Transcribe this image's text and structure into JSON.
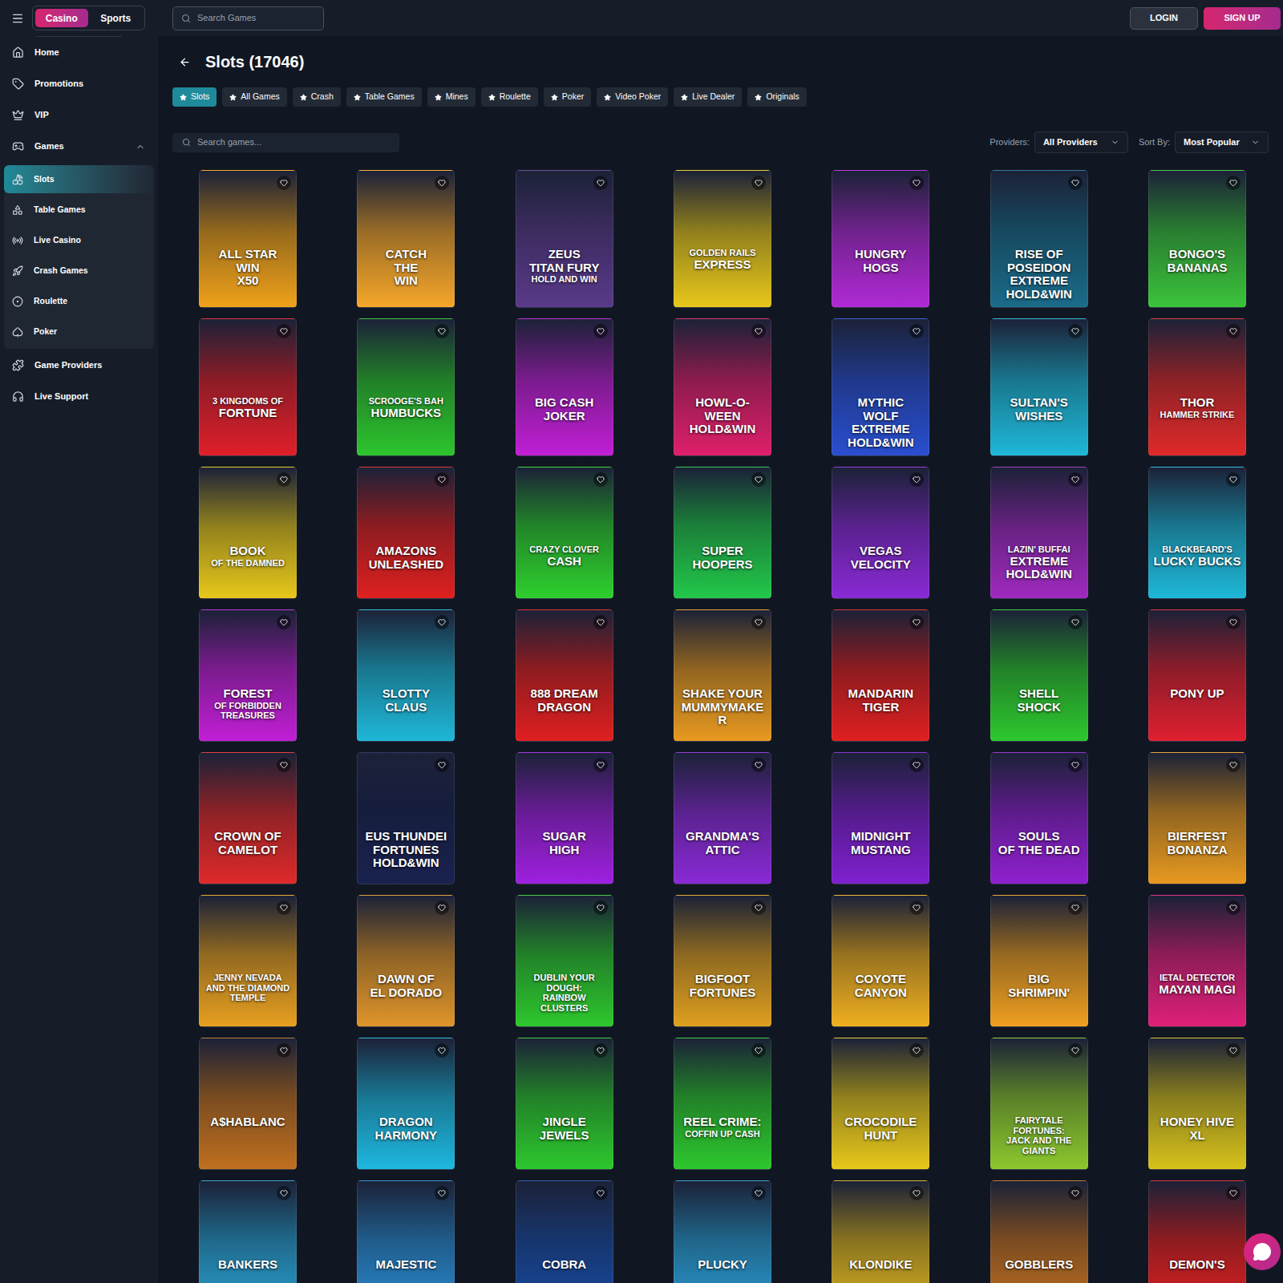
{
  "topbar": {
    "mode_toggle": [
      {
        "label": "Casino",
        "selected": true
      },
      {
        "label": "Sports",
        "selected": false
      }
    ],
    "search": {
      "placeholder": "Search Games"
    },
    "buttons": [
      {
        "label": "LOGIN",
        "kind": "secondary"
      },
      {
        "label": "SIGN UP",
        "kind": "primary"
      }
    ]
  },
  "sidebar": {
    "items": [
      {
        "label": "Home",
        "expanded": false,
        "children": []
      },
      {
        "label": "Promotions",
        "expanded": false,
        "children": []
      },
      {
        "label": "VIP",
        "expanded": false,
        "children": []
      },
      {
        "label": "Games",
        "expanded": true,
        "children": [
          {
            "label": "Slots",
            "selected": true
          },
          {
            "label": "Table Games",
            "selected": false
          },
          {
            "label": "Live Casino",
            "selected": false
          },
          {
            "label": "Crash Games",
            "selected": false
          },
          {
            "label": "Roulette",
            "selected": false
          },
          {
            "label": "Poker",
            "selected": false
          }
        ]
      },
      {
        "label": "Game Providers",
        "expanded": false,
        "children": []
      },
      {
        "label": "Live Support",
        "expanded": false,
        "children": []
      }
    ]
  },
  "page": {
    "title": "Slots (17046)",
    "filters": [
      {
        "label": "Slots",
        "selected": true
      },
      {
        "label": "All Games",
        "selected": false
      },
      {
        "label": "Crash",
        "selected": false
      },
      {
        "label": "Table Games",
        "selected": false
      },
      {
        "label": "Mines",
        "selected": false
      },
      {
        "label": "Roulette",
        "selected": false
      },
      {
        "label": "Poker",
        "selected": false
      },
      {
        "label": "Video Poker",
        "selected": false
      },
      {
        "label": "Live Dealer",
        "selected": false
      },
      {
        "label": "Originals",
        "selected": false
      }
    ],
    "search": {
      "placeholder": "Search games..."
    },
    "providers": {
      "label": "Providers:",
      "value": "All Providers"
    },
    "sort": {
      "label": "Sort By:",
      "value": "Most Popular"
    }
  },
  "games": [
    {
      "lines": [
        "ALL STAR",
        "WIN",
        "X50"
      ],
      "color": "#f0a21a"
    },
    {
      "lines": [
        "CATCH",
        "THE",
        "WIN"
      ],
      "color": "#f7a72a"
    },
    {
      "lines": [
        "ZEUS",
        "TITAN FURY",
        "HOLD AND WIN"
      ],
      "color": "#5a3a8a"
    },
    {
      "lines": [
        "GOLDEN RAILS",
        "EXPRESS"
      ],
      "color": "#e8c81b"
    },
    {
      "lines": [
        "HUNGRY",
        "HOGS"
      ],
      "color": "#b12ad6"
    },
    {
      "lines": [
        "RISE OF",
        "POSEIDON",
        "EXTREME",
        "HOLD&WIN"
      ],
      "color": "#1b6c8a"
    },
    {
      "lines": [
        "BONGO'S",
        "BANANAS"
      ],
      "color": "#3bc43b"
    },
    {
      "lines": [
        "3 KINGDOMS OF",
        "FORTUNE"
      ],
      "color": "#e0202a"
    },
    {
      "lines": [
        "SCROOGE'S BAH",
        "HUMBUCKS"
      ],
      "color": "#2dc62d"
    },
    {
      "lines": [
        "BIG CASH",
        "JOKER"
      ],
      "color": "#c21fd6"
    },
    {
      "lines": [
        "HOWL-O-WEEN",
        "HOLD&WIN"
      ],
      "color": "#e0206a"
    },
    {
      "lines": [
        "MYTHIC",
        "WOLF",
        "EXTREME",
        "HOLD&WIN"
      ],
      "color": "#2a4fd0"
    },
    {
      "lines": [
        "SULTAN'S",
        "WISHES"
      ],
      "color": "#1fb8d8"
    },
    {
      "lines": [
        "THOR",
        "HAMMER STRIKE"
      ],
      "color": "#e02a2a"
    },
    {
      "lines": [
        "BOOK",
        "OF THE DAMNED"
      ],
      "color": "#e8c81b"
    },
    {
      "lines": [
        "AMAZONS",
        "UNLEASHED"
      ],
      "color": "#e02020"
    },
    {
      "lines": [
        "CRAZY CLOVER",
        "CASH"
      ],
      "color": "#2ed02e"
    },
    {
      "lines": [
        "SUPER",
        "HOOPERS"
      ],
      "color": "#23c84a"
    },
    {
      "lines": [
        "VEGAS",
        "VELOCITY"
      ],
      "color": "#8a2ad6"
    },
    {
      "lines": [
        "LAZIN' BUFFAI",
        "EXTREME",
        "HOLD&WIN"
      ],
      "color": "#a02ac0"
    },
    {
      "lines": [
        "BLACKBEARD'S",
        "LUCKY BUCKS"
      ],
      "color": "#1fb8d8"
    },
    {
      "lines": [
        "FOREST",
        "OF FORBIDDEN TREASURES"
      ],
      "color": "#c21fd6"
    },
    {
      "lines": [
        "SLOTTY",
        "CLAUS"
      ],
      "color": "#1fb8d8"
    },
    {
      "lines": [
        "888 DREAM",
        "DRAGON"
      ],
      "color": "#e02020"
    },
    {
      "lines": [
        "SHAKE YOUR",
        "MUMMYMAKER"
      ],
      "color": "#e89a20"
    },
    {
      "lines": [
        "MANDARIN",
        "TIGER"
      ],
      "color": "#e02020"
    },
    {
      "lines": [
        "SHELL",
        "SHOCK"
      ],
      "color": "#2ec82e"
    },
    {
      "lines": [
        "PONY UP"
      ],
      "color": "#e02030"
    },
    {
      "lines": [
        "CROWN OF",
        "CAMELOT"
      ],
      "color": "#e02a2a"
    },
    {
      "lines": [
        "EUS THUNDEI",
        "FORTUNES",
        "HOLD&WIN"
      ],
      "color": "#1a2250"
    },
    {
      "lines": [
        "SUGAR",
        "HIGH"
      ],
      "color": "#a020e0"
    },
    {
      "lines": [
        "GRANDMA'S",
        "ATTIC"
      ],
      "color": "#8a2ad6"
    },
    {
      "lines": [
        "MIDNIGHT",
        "MUSTANG"
      ],
      "color": "#8020d0"
    },
    {
      "lines": [
        "SOULS",
        "OF THE DEAD"
      ],
      "color": "#9020d0"
    },
    {
      "lines": [
        "BIERFEST",
        "BONANZA"
      ],
      "color": "#e89a20"
    },
    {
      "lines": [
        "JENNY NEVADA",
        "AND THE DIAMOND TEMPLE"
      ],
      "color": "#e8a020"
    },
    {
      "lines": [
        "DAWN OF",
        "EL DORADO"
      ],
      "color": "#e0952a"
    },
    {
      "lines": [
        "DUBLIN YOUR DOUGH:",
        "RAINBOW CLUSTERS"
      ],
      "color": "#2ec82e"
    },
    {
      "lines": [
        "BIGFOOT",
        "FORTUNES"
      ],
      "color": "#e0a020"
    },
    {
      "lines": [
        "COYOTE",
        "CANYON"
      ],
      "color": "#f0b020"
    },
    {
      "lines": [
        "BIG",
        "SHRIMPIN'"
      ],
      "color": "#f0a020"
    },
    {
      "lines": [
        "IETAL DETECTOR",
        "MAYAN MAGI"
      ],
      "color": "#e0207a"
    },
    {
      "lines": [
        "A$HABLANC"
      ],
      "color": "#c07020"
    },
    {
      "lines": [
        "DRAGON",
        "HARMONY"
      ],
      "color": "#1fb8e0"
    },
    {
      "lines": [
        "JINGLE",
        "JEWELS"
      ],
      "color": "#2ec82e"
    },
    {
      "lines": [
        "REEL CRIME:",
        "COFFIN UP CASH"
      ],
      "color": "#2ec82e"
    },
    {
      "lines": [
        "CROCODILE",
        "HUNT"
      ],
      "color": "#e8c81b"
    },
    {
      "lines": [
        "FAIRYTALE FORTUNES:",
        "JACK AND THE GIANTS"
      ],
      "color": "#8cc82e"
    },
    {
      "lines": [
        "HONEY HIVE",
        "XL"
      ],
      "color": "#d8c21b"
    },
    {
      "lines": [
        "BANKERS"
      ],
      "color": "#2aa0d0"
    },
    {
      "lines": [
        "MAJESTIC"
      ],
      "color": "#2a8ad0"
    },
    {
      "lines": [
        "COBRA"
      ],
      "color": "#1a4aa0"
    },
    {
      "lines": [
        "PLUCKY"
      ],
      "color": "#2a9ad0"
    },
    {
      "lines": [
        "KLONDIKE"
      ],
      "color": "#d8b020"
    },
    {
      "lines": [
        "GOBBLERS"
      ],
      "color": "#c07020"
    },
    {
      "lines": [
        "DEMON'S"
      ],
      "color": "#e02020"
    }
  ]
}
